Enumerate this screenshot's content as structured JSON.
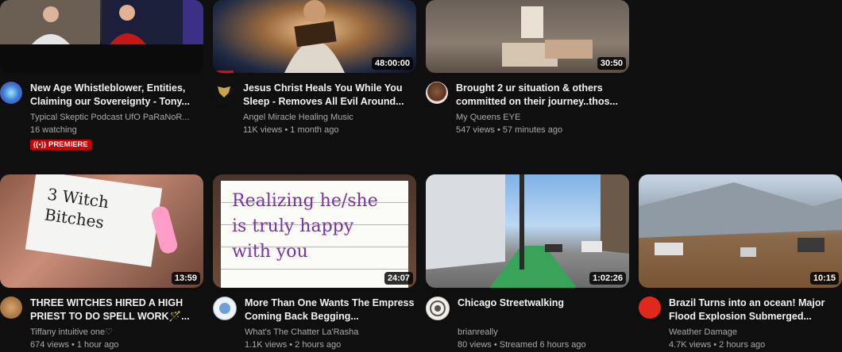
{
  "videos": [
    {
      "title": "New Age Whistleblower, Entities, Claiming our Sovereignty - Tony...",
      "channel": "Typical Skeptic Podcast UfO PaRaNoR...",
      "stats": "16 watching",
      "badge": "PREMIERE",
      "duration": ""
    },
    {
      "title": "Jesus Christ Heals You While You Sleep - Removes All Evil Around...",
      "channel": "Angel Miracle Healing Music",
      "stats": "11K views • 1 month ago",
      "duration": "48:00:00",
      "progress": 0.1
    },
    {
      "title": "Brought 2 ur situation & others committed on their journey..thos...",
      "channel": "My Queens EYE",
      "stats": "547 views • 57 minutes ago",
      "duration": "30:50"
    },
    {
      "title": "THREE WITCHES HIRED A HIGH PRIEST TO DO SPELL WORK🪄...",
      "channel": "Tiffany intuitive one♡",
      "stats": "674 views • 1 hour ago",
      "duration": "13:59",
      "card_text": [
        "3 Witch",
        "Bitches"
      ]
    },
    {
      "title": "More Than One Wants The Empress Coming Back Begging...",
      "channel": "What's The Chatter La'Rasha",
      "stats": "1.1K views • 2 hours ago",
      "duration": "24:07",
      "card_text": [
        "Realizing he/she",
        "is truly happy",
        "with you"
      ]
    },
    {
      "title": "Chicago Streetwalking",
      "channel": "brianreally",
      "stats": "80 views • Streamed 6 hours ago",
      "duration": "1:02:26"
    },
    {
      "title": "Brazil Turns into an ocean! Major Flood Explosion Submerged...",
      "channel": "Weather Damage",
      "stats": "4.7K views • 2 hours ago",
      "duration": "10:15"
    }
  ]
}
